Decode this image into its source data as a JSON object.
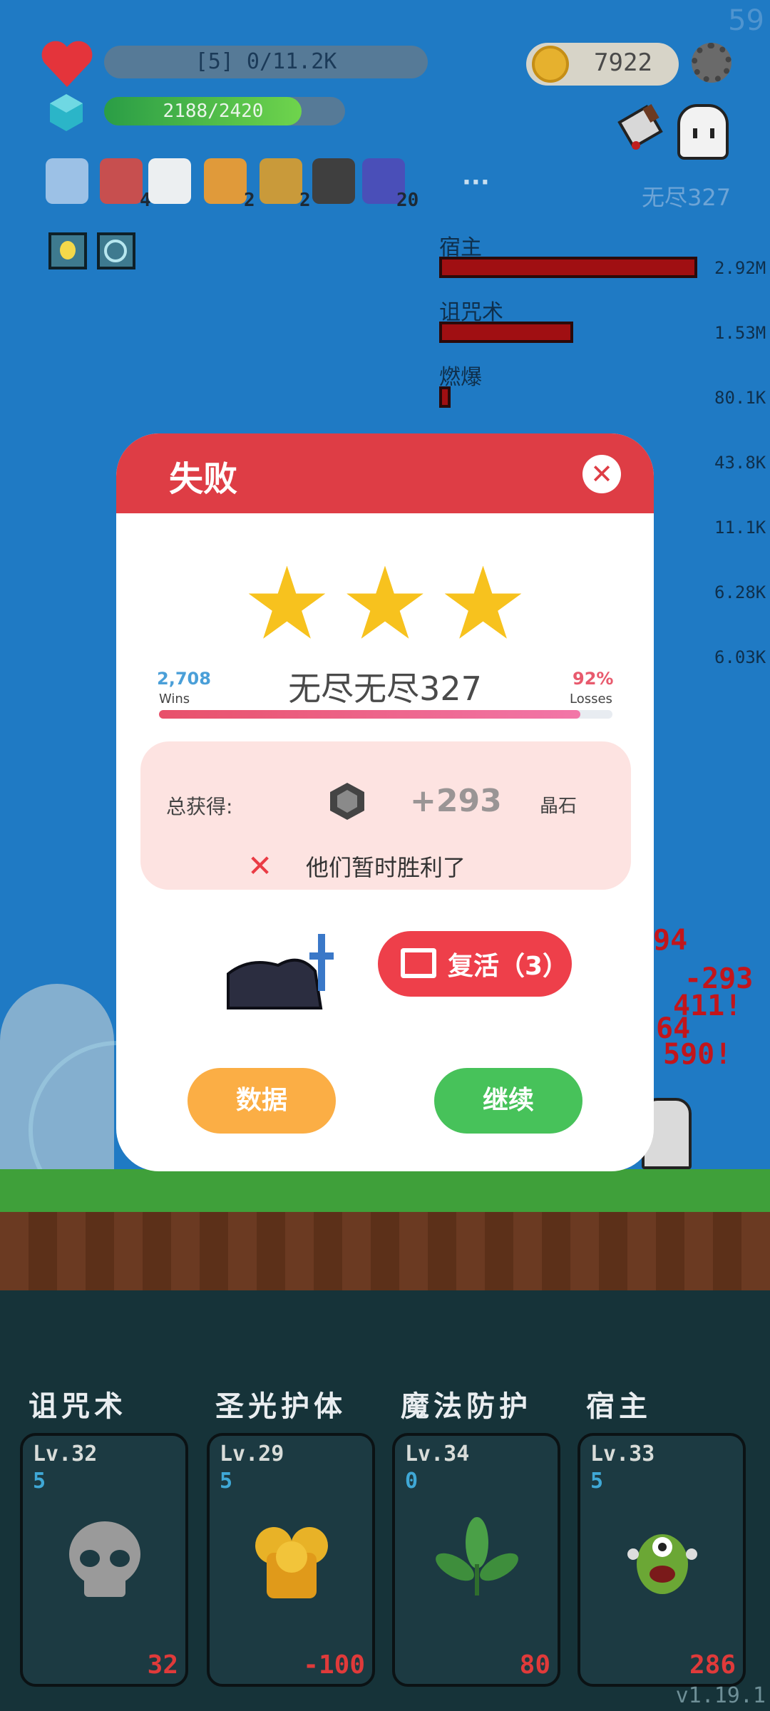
{
  "hud": {
    "fps": "59",
    "hp_text": "[5] 0/11.2K",
    "exp_text": "2188/2420",
    "exp_fraction": 0.904,
    "gold": "7922",
    "more": "···",
    "stage_label": "无尽327"
  },
  "items": [
    {
      "icon": "robe-icon",
      "count": ""
    },
    {
      "icon": "tombstone-icon",
      "count": "4"
    },
    {
      "icon": "chat-bubble-icon",
      "count": ""
    },
    {
      "icon": "briefcase-icon",
      "count": "2"
    },
    {
      "icon": "book-icon",
      "count": "2"
    },
    {
      "icon": "mortar-icon",
      "count": ""
    },
    {
      "icon": "wizard-hat-icon",
      "count": "20"
    }
  ],
  "damage": [
    {
      "name": "宿主",
      "value": "2.92M",
      "fraction": 1.0
    },
    {
      "name": "诅咒术",
      "value": "1.53M",
      "fraction": 0.52
    },
    {
      "name": "燃爆",
      "value": "80.1K",
      "fraction": 0.03
    },
    {
      "name": "",
      "value": "43.8K"
    },
    {
      "name": "",
      "value": "11.1K"
    },
    {
      "name": "",
      "value": "6.28K"
    },
    {
      "name": "",
      "value": "6.03K"
    }
  ],
  "dialog": {
    "title": "失败",
    "close": "✕",
    "stars": 3,
    "wins_num": "2,708",
    "wins_label": "Wins",
    "loss_num": "92%",
    "loss_label": "Losses",
    "stage_name": "无尽无尽327",
    "progress_fraction": 0.93,
    "reward_label": "总获得:",
    "reward_value": "+293",
    "reward_unit": "晶石",
    "result_msg": "他们暂时胜利了",
    "revive_label": "复活（3）",
    "data_label": "数据",
    "continue_label": "继续"
  },
  "floating_damage": [
    "94",
    "-293",
    "411!",
    "64",
    "590!"
  ],
  "skills": [
    {
      "title": "诅咒术",
      "lv": "Lv.32",
      "sub": "5",
      "cost": "32",
      "icon": "skull-icon"
    },
    {
      "title": "圣光护体",
      "lv": "Lv.29",
      "sub": "5",
      "cost": "-100",
      "icon": "golden-armor-icon"
    },
    {
      "title": "魔法防护",
      "lv": "Lv.34",
      "sub": "0",
      "cost": "80",
      "icon": "leaf-icon"
    },
    {
      "title": "宿主",
      "lv": "Lv.33",
      "sub": "5",
      "cost": "286",
      "icon": "green-monster-icon"
    }
  ],
  "version": "v1.19.1",
  "colors": {
    "primary_red": "#de3d45",
    "gold": "#e6b12e",
    "green": "#47c25a",
    "orange": "#fbae45"
  }
}
